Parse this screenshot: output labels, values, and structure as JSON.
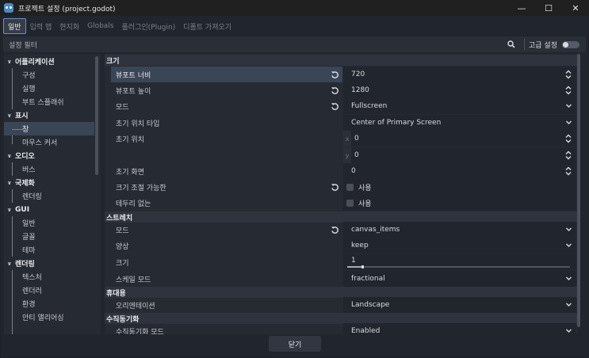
{
  "window": {
    "title": "프로젝트 설정 (project.godot)",
    "minimize": "—",
    "maximize": "☐",
    "close": "✕"
  },
  "tabs": [
    {
      "label": "일반",
      "active": true
    },
    {
      "label": "입력 맵"
    },
    {
      "label": "현지화"
    },
    {
      "label": "Globals"
    },
    {
      "label": "플러그인(Plugin)"
    },
    {
      "label": "디폴트 가져오기"
    }
  ],
  "filter": {
    "placeholder": "설정 필터",
    "advanced_label": "고급 설정",
    "advanced_on": false
  },
  "sidebar": {
    "groups": [
      {
        "label": "어플리케이션",
        "items": [
          "구성",
          "실행",
          "부트 스플래쉬"
        ]
      },
      {
        "label": "표시",
        "items": [
          "창",
          "마우스 커서"
        ],
        "selected": "창"
      },
      {
        "label": "오디오",
        "items": [
          "버스"
        ]
      },
      {
        "label": "국제화",
        "items": [
          "렌더링"
        ]
      },
      {
        "label": "GUI",
        "items": [
          "일반",
          "글꼴",
          "테마"
        ]
      },
      {
        "label": "렌더링",
        "items": [
          "텍스처",
          "렌더러",
          "환경",
          "안티 앨리어싱"
        ]
      }
    ]
  },
  "inspector": {
    "sections": {
      "size": "크기",
      "stretch": "스트레치",
      "handheld": "휴대용",
      "vsync": "수직동기화"
    },
    "size": {
      "viewport_width": {
        "label": "뷰포트 너비",
        "value": "720"
      },
      "viewport_height": {
        "label": "뷰포트 높이",
        "value": "1280"
      },
      "mode": {
        "label": "모드",
        "value": "Fullscreen"
      },
      "initial_position_type": {
        "label": "초기 위치 타입",
        "value": "Center of Primary Screen"
      },
      "initial_position": {
        "label": "초기 위치",
        "x_axis": "x",
        "x": "0",
        "y_axis": "y",
        "y": "0"
      },
      "initial_screen": {
        "label": "초기 화면",
        "value": "0"
      },
      "resizable": {
        "label": "크기 조절 가능한",
        "value": "사용"
      },
      "borderless": {
        "label": "테두리 없는",
        "value": "사용"
      }
    },
    "stretch": {
      "mode": {
        "label": "모드",
        "value": "canvas_items"
      },
      "aspect": {
        "label": "양상",
        "value": "keep"
      },
      "scale": {
        "label": "크기",
        "value": "1"
      },
      "scale_mode": {
        "label": "스케일 모드",
        "value": "fractional"
      }
    },
    "handheld": {
      "orientation": {
        "label": "오리엔테이션",
        "value": "Landscape"
      }
    },
    "vsync": {
      "vsync_mode": {
        "label": "수직동기화 모드",
        "value": "Enabled"
      }
    }
  },
  "footer": {
    "close_label": "닫기"
  },
  "colors": {
    "accent": "#6f8fc4",
    "selection": "#3a4556",
    "panel": "#262a33",
    "background": "#21252d"
  }
}
